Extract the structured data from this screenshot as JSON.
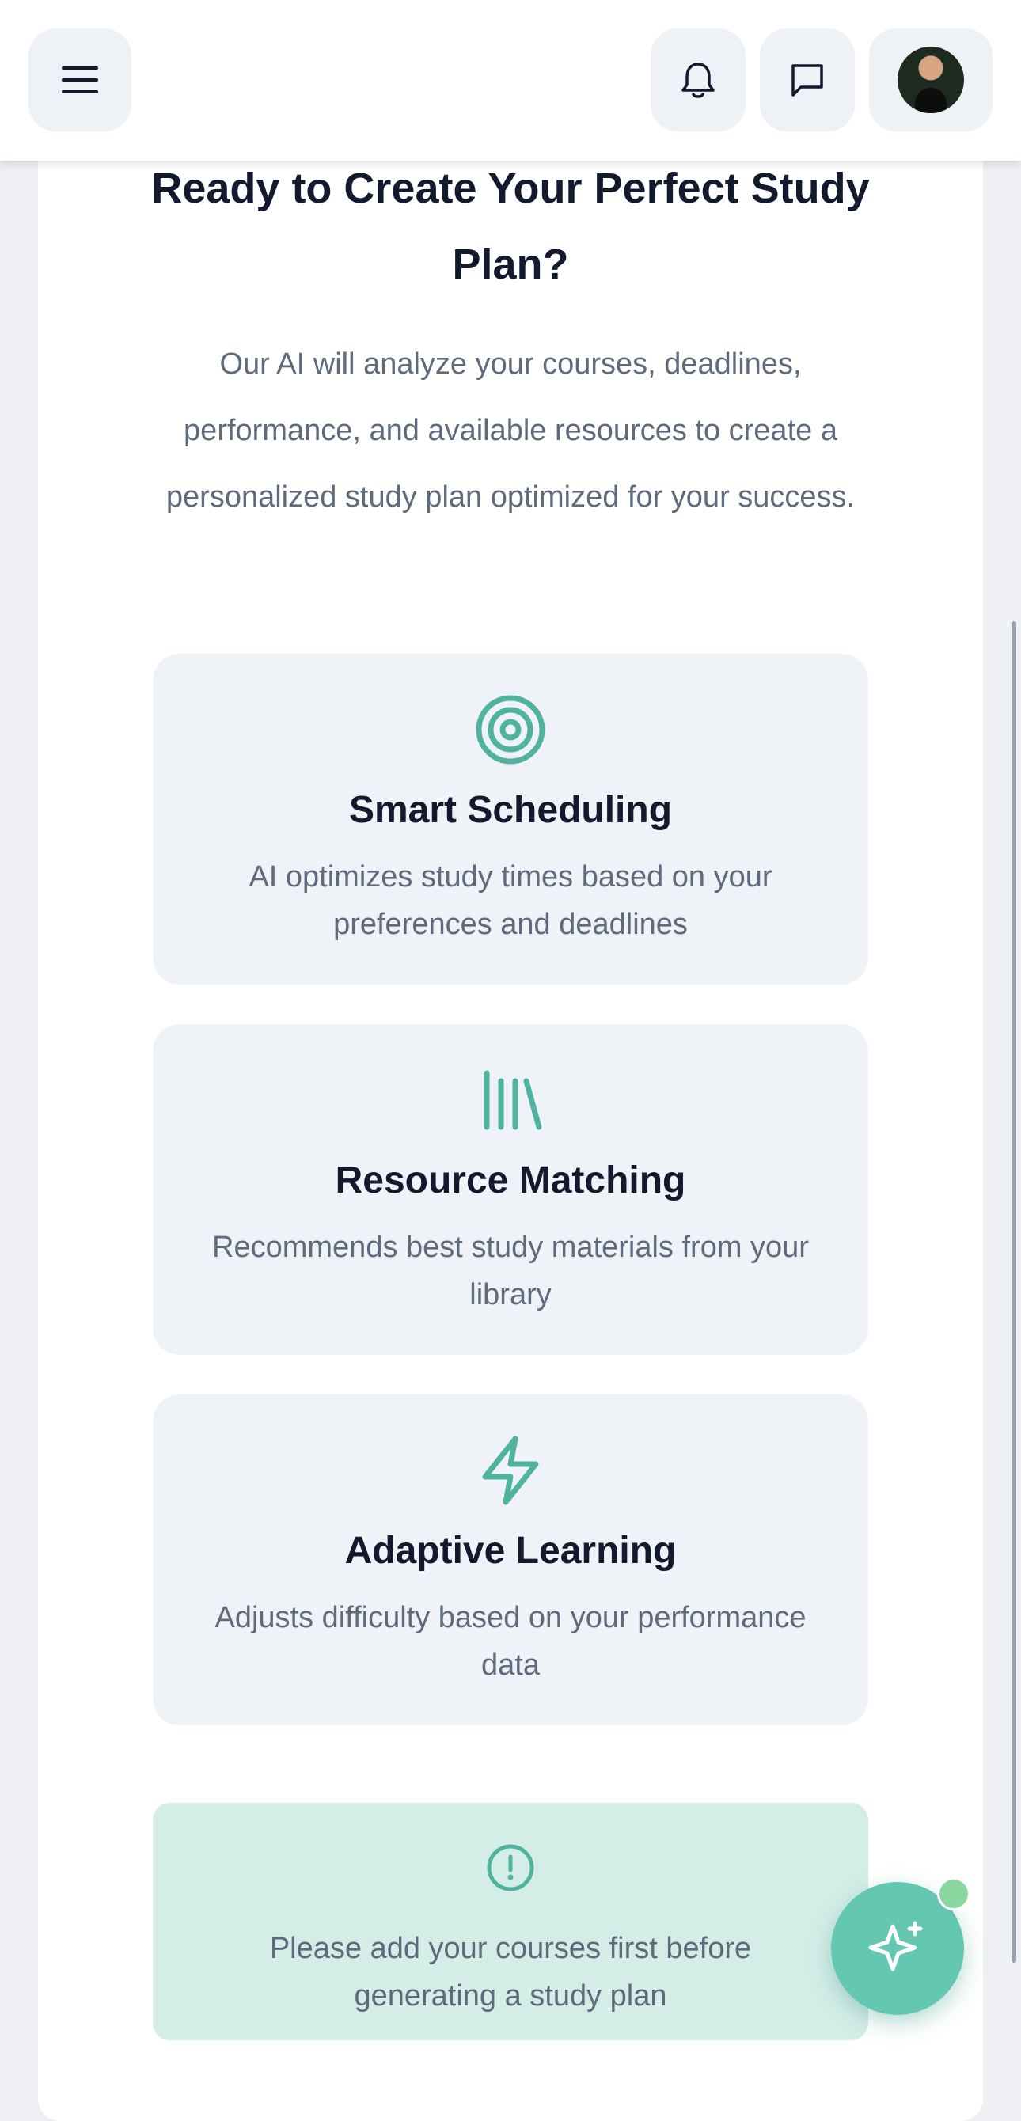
{
  "header": {
    "menu_icon": "hamburger-menu-icon",
    "notifications_icon": "bell-icon",
    "messages_icon": "chat-bubble-icon",
    "avatar": "user-avatar"
  },
  "main": {
    "title": "Ready to Create Your Perfect Study Plan?",
    "intro": "Our AI will analyze your courses, deadlines, performance, and available resources to create a personalized study plan optimized for your success.",
    "features": [
      {
        "icon": "target-icon",
        "title": "Smart Scheduling",
        "description": "AI optimizes study times based on your preferences and deadlines"
      },
      {
        "icon": "library-icon",
        "title": "Resource Matching",
        "description": "Recommends best study materials from your library"
      },
      {
        "icon": "lightning-icon",
        "title": "Adaptive Learning",
        "description": "Adjusts difficulty based on your performance data"
      }
    ],
    "notice": {
      "icon": "alert-circle-icon",
      "text": "Please add your courses first before generating a study plan"
    }
  },
  "fab": {
    "icon": "sparkles-icon",
    "status": "online-indicator"
  },
  "colors": {
    "accent": "#4fb3a0",
    "heading": "#131a2e",
    "body_text": "#5f6b7d",
    "card_bg": "#eff2f7",
    "notice_bg": "#d4ede7",
    "fab": "#63c7b2"
  }
}
